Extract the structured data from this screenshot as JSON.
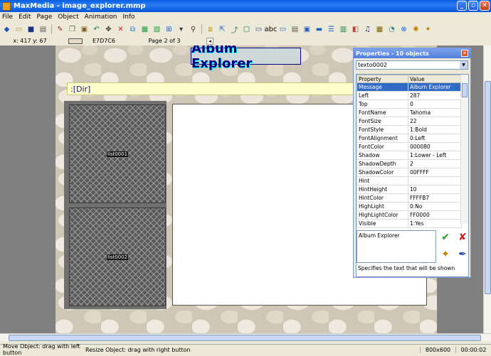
{
  "window": {
    "title": "MaxMedia - image_explorer.mmp"
  },
  "menu": [
    "File",
    "Edit",
    "Page",
    "Object",
    "Animation",
    "Info"
  ],
  "toolbar": {
    "icons": [
      "new-icon",
      "open-icon",
      "save-icon",
      "print-icon",
      "paint-icon",
      "copy-icon",
      "paste-icon",
      "undo-icon",
      "move-icon",
      "delete-icon",
      "group-icon",
      "align-icon",
      "distribute-icon",
      "grid-icon",
      "more-icon",
      "find-icon",
      "layer-icon",
      "arrange-icon",
      "bring-icon",
      "frame-icon",
      "screen-icon",
      "text-icon",
      "label-icon",
      "memo-icon",
      "image-icon",
      "button-icon",
      "list-icon",
      "edit-icon",
      "shape-icon",
      "sound-icon",
      "video-icon",
      "timer-icon",
      "link-icon",
      "web-icon",
      "wand-icon"
    ]
  },
  "infobar": {
    "coords": "x: 417  y: 67",
    "color_hex": "E7D7C6",
    "color_value": "#e7d7c6",
    "page": "Page 2 of 3"
  },
  "canvas": {
    "title_text": "Album Explorer",
    "dir_label": ":[Dir]",
    "list1": "list0001",
    "list2": "list0002"
  },
  "properties": {
    "title": "Properties - 10 objects",
    "selected_object": "texto0002",
    "headers": {
      "property": "Property",
      "value": "Value"
    },
    "rows": [
      {
        "property": "Message",
        "value": "Album Explorer"
      },
      {
        "property": "Left",
        "value": "287"
      },
      {
        "property": "Top",
        "value": "0"
      },
      {
        "property": "FontName",
        "value": "Tahoma"
      },
      {
        "property": "FontSize",
        "value": "22"
      },
      {
        "property": "FontStyle",
        "value": "1:Bold"
      },
      {
        "property": "FontAlignment",
        "value": "0:Left"
      },
      {
        "property": "FontColor",
        "value": "000080"
      },
      {
        "property": "Shadow",
        "value": "1:Lower - Left"
      },
      {
        "property": "ShadowDepth",
        "value": "2"
      },
      {
        "property": "ShadowColor",
        "value": "00FFFF"
      },
      {
        "property": "Hint",
        "value": ""
      },
      {
        "property": "HintHeight",
        "value": "10"
      },
      {
        "property": "HintColor",
        "value": "FFFFB7"
      },
      {
        "property": "HighLight",
        "value": "0:No"
      },
      {
        "property": "HighLightColor",
        "value": "FF0000"
      },
      {
        "property": "Visible",
        "value": "1:Yes"
      }
    ],
    "value_text": "Album Explorer",
    "hint": "Specifies the text that will be shown"
  },
  "status": {
    "msg1": "Move Object: drag with left button",
    "msg2": "Resize Object: drag with right button",
    "resolution": "800x600",
    "time": "00:00:02"
  }
}
